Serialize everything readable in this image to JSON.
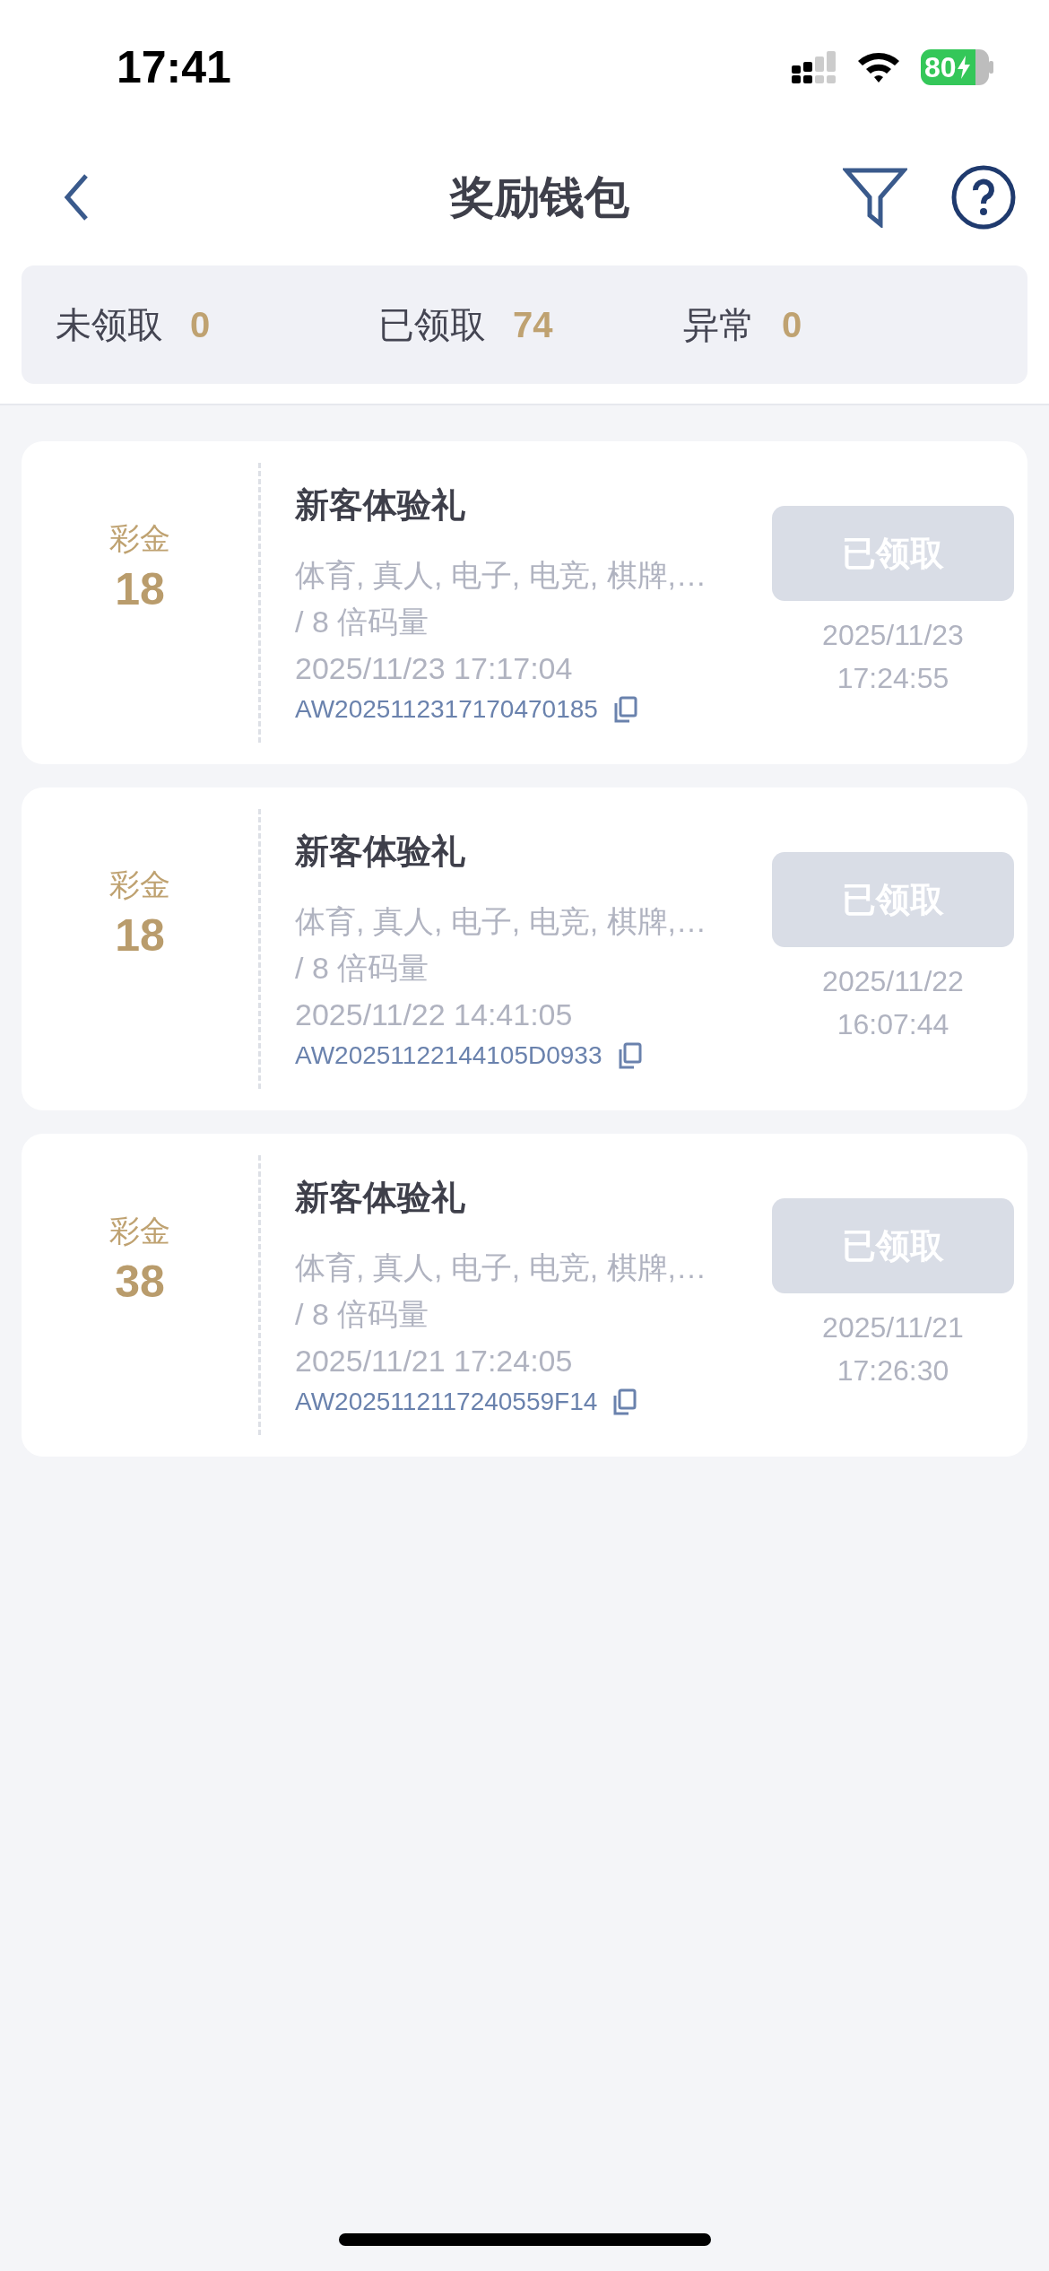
{
  "status_bar": {
    "time": "17:41",
    "battery": "80"
  },
  "header": {
    "title": "奖励钱包"
  },
  "stats": [
    {
      "label": "未领取",
      "count": "0"
    },
    {
      "label": "已领取",
      "count": "74"
    },
    {
      "label": "异常",
      "count": "0"
    }
  ],
  "rewards": [
    {
      "type_label": "彩金",
      "amount": "18",
      "title": "新客体验礼",
      "games": "体育, 真人, 电子, 电竞, 棋牌,…",
      "wager": "/ 8 倍码量",
      "issued": "2025/11/23 17:17:04",
      "code": "AW2025112317170470185",
      "button": "已领取",
      "disabled": true,
      "claim_date": "2025/11/23",
      "claim_time": "17:24:55"
    },
    {
      "type_label": "彩金",
      "amount": "18",
      "title": "新客体验礼",
      "games": "体育, 真人, 电子, 电竞, 棋牌,…",
      "wager": "/ 8 倍码量",
      "issued": "2025/11/22 14:41:05",
      "code": "AW20251122144105D0933",
      "button": "已领取",
      "disabled": true,
      "claim_date": "2025/11/22",
      "claim_time": "16:07:44"
    },
    {
      "type_label": "彩金",
      "amount": "38",
      "title": "新客体验礼",
      "games": "体育, 真人, 电子, 电竞, 棋牌,…",
      "wager": "/ 8 倍码量",
      "issued": "2025/11/21 17:24:05",
      "code": "AW2025112117240559F14",
      "button": "已领取",
      "disabled": true,
      "claim_date": "2025/11/21",
      "claim_time": "17:26:30"
    }
  ]
}
